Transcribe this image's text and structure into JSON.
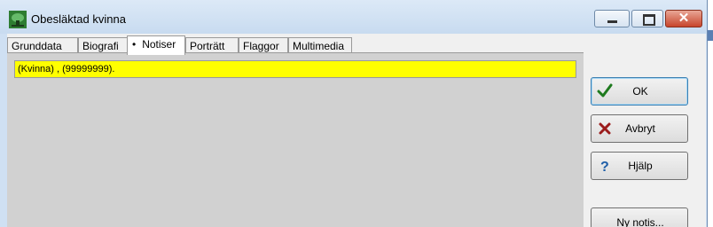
{
  "window": {
    "title": "Obesläktad kvinna"
  },
  "tabs": [
    {
      "label": "Grunddata"
    },
    {
      "label": "Biografi"
    },
    {
      "label": "Notiser",
      "marker": "•"
    },
    {
      "label": "Porträtt"
    },
    {
      "label": "Flaggor"
    },
    {
      "label": "Multimedia"
    }
  ],
  "active_tab": "Notiser",
  "notes": [
    {
      "text": "(Kvinna) ,  (99999999)."
    }
  ],
  "buttons": {
    "ok": "OK",
    "cancel": "Avbryt",
    "help": "Hjälp",
    "new_note": "Ny notis..."
  },
  "icons": {
    "ok": "checkmark-icon",
    "cancel": "red-x-icon",
    "help": "question-mark-icon",
    "app": "tree-icon"
  },
  "colors": {
    "note_highlight": "#ffff00",
    "panel": "#d1d1d1",
    "titlebar": "#cfe0f3"
  }
}
